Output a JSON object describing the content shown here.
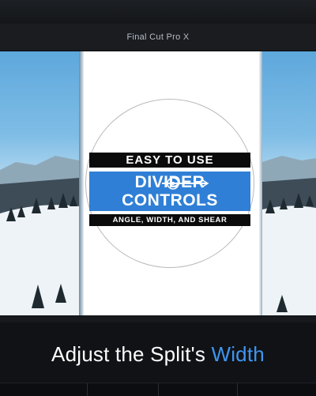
{
  "window": {
    "title": "Final Cut Pro X"
  },
  "overlay": {
    "top_banner": "EASY TO USE",
    "main_line1": "DIVIDER",
    "main_line2": "CONTROLS",
    "bottom_banner": "ANGLE, WIDTH, AND SHEAR"
  },
  "caption": {
    "prefix": "Adjust the Split's ",
    "highlight": "Width"
  },
  "colors": {
    "accent": "#3f95f0",
    "banner_blue": "#2f7fd6",
    "background": "#0c0e11"
  },
  "icons": {
    "divider_handle": "divider-handle-icon"
  }
}
